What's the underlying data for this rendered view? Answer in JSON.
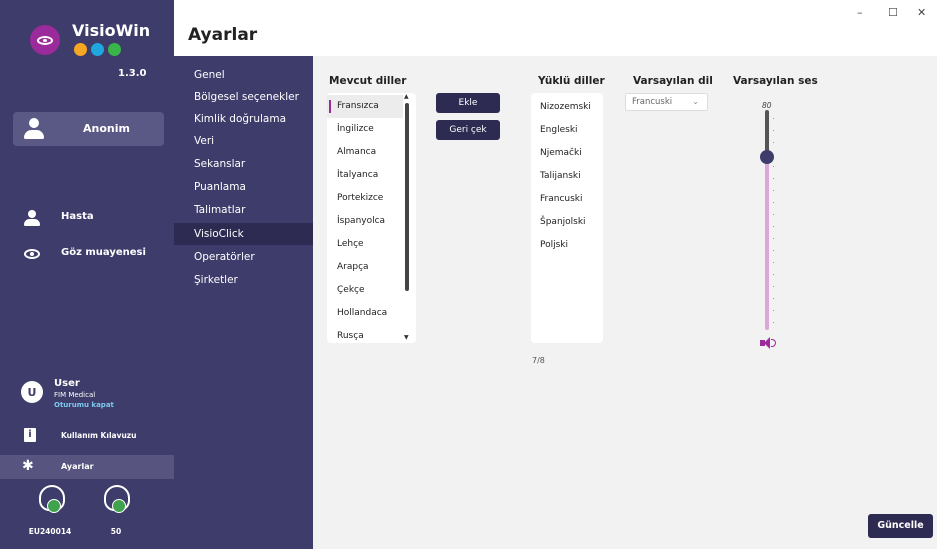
{
  "app": {
    "name": "VisioWin",
    "version": "1.3.0",
    "brand_colors": [
      "#f5a623",
      "#1fa8e0",
      "#3ab54a"
    ]
  },
  "sidebar": {
    "anon_label": "Anonim",
    "items": [
      {
        "label": "Hasta",
        "icon": "person-icon"
      },
      {
        "label": "Göz muayenesi",
        "icon": "eye-icon"
      }
    ],
    "user": {
      "initial": "U",
      "name": "User",
      "company": "FIM Medical",
      "logout": "Oturumu kapat"
    },
    "guide_label": "Kullanım Kılavuzu",
    "settings_label": "Ayarlar",
    "devices": [
      {
        "caption": "EU240014",
        "icon": "visiotest-device-icon",
        "status": "connected"
      },
      {
        "caption": "50",
        "icon": "headset-device-icon",
        "status": "connected"
      }
    ]
  },
  "header": {
    "title": "Ayarlar"
  },
  "settings_nav": {
    "active_index": 7,
    "items": [
      "Genel",
      "Bölgesel seçenekler",
      "Kimlik doğrulama",
      "Veri",
      "Sekanslar",
      "Puanlama",
      "Talimatlar",
      "VisioClick",
      "Operatörler",
      "Şirketler"
    ]
  },
  "main": {
    "available_label": "Mevcut diller",
    "available": [
      "Fransızca",
      "İngilizce",
      "Almanca",
      "İtalyanca",
      "Portekizce",
      "İspanyolca",
      "Lehçe",
      "Arapça",
      "Çekçe",
      "Hollandaca",
      "Rusça"
    ],
    "available_selected_index": 0,
    "add_button": "Ekle",
    "remove_button": "Geri çek",
    "installed_label": "Yüklü diller",
    "installed": [
      "Nizozemski",
      "Engleski",
      "Njemački",
      "Talijanski",
      "Francuski",
      "Španjolski",
      "Poljski"
    ],
    "installed_count": "7/8",
    "default_lang_label": "Varsayılan dil",
    "default_lang_value": "Francuski",
    "default_volume_label": "Varsayılan ses",
    "default_volume_value": "80",
    "update_button": "Güncelle"
  },
  "window": {
    "minimize": "–",
    "maximize": "☐",
    "close": "✕"
  }
}
